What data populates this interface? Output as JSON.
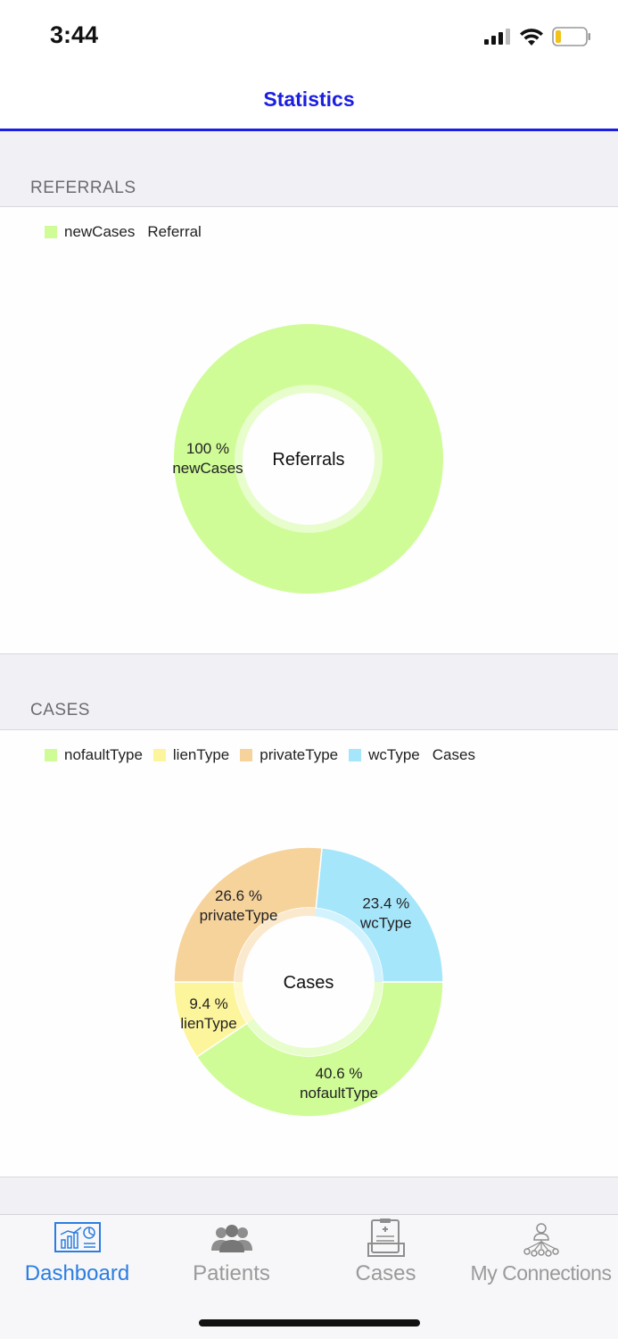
{
  "status": {
    "time": "3:44"
  },
  "nav": {
    "title": "Statistics"
  },
  "colors": {
    "accent": "#1a1ee0",
    "tab_active": "#2a7de1",
    "tab_inactive": "#9a9a9a",
    "nofault": "#cffc97",
    "lien": "#fdf59c",
    "private": "#f7d39c",
    "wc": "#a6e6fb"
  },
  "sections": {
    "referrals": {
      "header": "REFERRALS"
    },
    "cases": {
      "header": "CASES"
    }
  },
  "referrals": {
    "legend": {
      "items": [
        {
          "label": "newCases"
        }
      ],
      "title": "Referral"
    },
    "center_label": "Referrals"
  },
  "cases": {
    "legend": {
      "items": [
        {
          "label": "nofaultType"
        },
        {
          "label": "lienType"
        },
        {
          "label": "privateType"
        },
        {
          "label": "wcType"
        }
      ],
      "title": "Cases"
    },
    "center_label": "Cases"
  },
  "chart_data": [
    {
      "type": "pie",
      "donut": true,
      "legend_title": "Referral",
      "center_label": "Referrals",
      "slices": [
        {
          "label": "newCases",
          "value": 100,
          "percent_label": "100 %",
          "color": "#cffc97"
        }
      ]
    },
    {
      "type": "pie",
      "donut": true,
      "legend_title": "Cases",
      "center_label": "Cases",
      "slices": [
        {
          "label": "nofaultType",
          "value": 40.6,
          "percent_label": "40.6 %",
          "color": "#cffc97"
        },
        {
          "label": "lienType",
          "value": 9.4,
          "percent_label": "9.4 %",
          "color": "#fdf59c"
        },
        {
          "label": "privateType",
          "value": 26.6,
          "percent_label": "26.6 %",
          "color": "#f7d39c"
        },
        {
          "label": "wcType",
          "value": 23.4,
          "percent_label": "23.4 %",
          "color": "#a6e6fb"
        }
      ]
    }
  ],
  "tabs": [
    {
      "label": "Dashboard",
      "icon": "dashboard-chart-icon",
      "active": true
    },
    {
      "label": "Patients",
      "icon": "patients-group-icon",
      "active": false
    },
    {
      "label": "Cases",
      "icon": "cases-clipboard-icon",
      "active": false
    },
    {
      "label": "My Connections",
      "icon": "connections-network-icon",
      "active": false
    }
  ]
}
